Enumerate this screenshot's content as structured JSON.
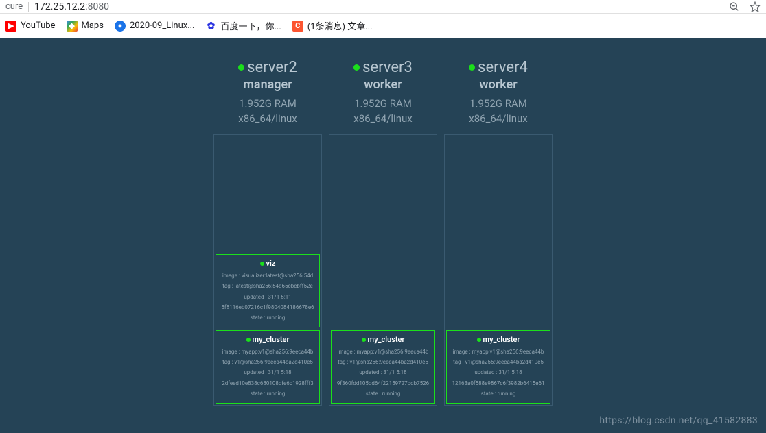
{
  "browser": {
    "secure_label": "cure",
    "url_host": "172.25.12.2",
    "url_port": ":8080"
  },
  "bookmarks": [
    {
      "label": "YouTube",
      "icon": "yt"
    },
    {
      "label": "Maps",
      "icon": "maps"
    },
    {
      "label": "2020-09_Linux...",
      "icon": "blue"
    },
    {
      "label": "百度一下，你...",
      "icon": "baidu"
    },
    {
      "label": "(1条消息) 文章...",
      "icon": "csdn"
    }
  ],
  "nodes": [
    {
      "name": "server2",
      "role": "manager",
      "ram": "1.952G RAM",
      "arch": "x86_64/linux",
      "tasks": [
        {
          "name": "viz",
          "image": "image : visualizer:latest@sha256:54d",
          "tag": "tag : latest@sha256:54d65cbcbff52e",
          "updated": "updated : 31/1 5:11",
          "id": "5f8116eb07216c1f9804084186678e6",
          "state": "state : running"
        },
        {
          "name": "my_cluster",
          "image": "image : myapp:v1@sha256:9eeca44b",
          "tag": "tag : v1@sha256:9eeca44ba2d410e5",
          "updated": "updated : 31/1 5:18",
          "id": "2dfeed10e838c680108dfe6c1928fff3",
          "state": "state : running"
        }
      ]
    },
    {
      "name": "server3",
      "role": "worker",
      "ram": "1.952G RAM",
      "arch": "x86_64/linux",
      "tasks": [
        {
          "name": "my_cluster",
          "image": "image : myapp:v1@sha256:9eeca44b",
          "tag": "tag : v1@sha256:9eeca44ba2d410e5",
          "updated": "updated : 31/1 5:18",
          "id": "9f360fdd105dd64f22159727bdb7526",
          "state": "state : running"
        }
      ]
    },
    {
      "name": "server4",
      "role": "worker",
      "ram": "1.952G RAM",
      "arch": "x86_64/linux",
      "tasks": [
        {
          "name": "my_cluster",
          "image": "image : myapp:v1@sha256:9eeca44b",
          "tag": "tag : v1@sha256:9eeca44ba2d410e5",
          "updated": "updated : 31/1 5:18",
          "id": "12163a0f588e9867c6f3982b6415e61",
          "state": "state : running"
        }
      ]
    }
  ],
  "watermark": "https://blog.csdn.net/qq_41582883"
}
